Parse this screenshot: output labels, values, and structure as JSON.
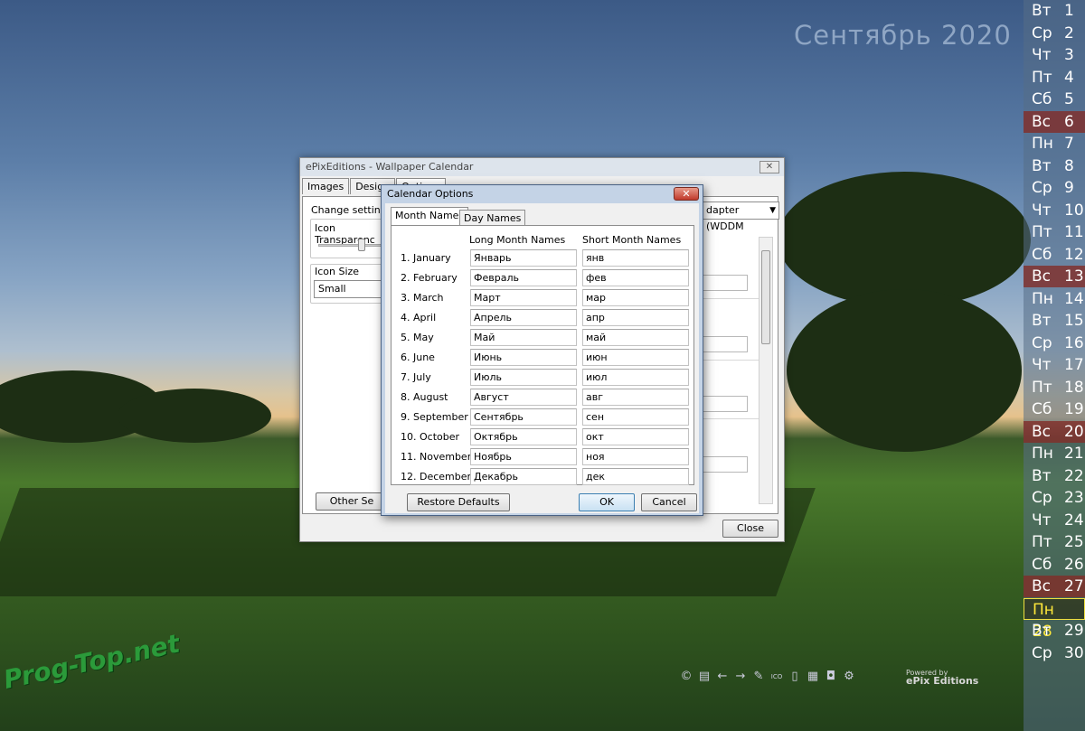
{
  "wallpaper": {
    "month_title": "Сентябрь 2020",
    "calendar_days": [
      {
        "dow": "Вт",
        "num": "1",
        "kind": "normal"
      },
      {
        "dow": "Ср",
        "num": "2",
        "kind": "normal"
      },
      {
        "dow": "Чт",
        "num": "3",
        "kind": "normal"
      },
      {
        "dow": "Пт",
        "num": "4",
        "kind": "normal"
      },
      {
        "dow": "Сб",
        "num": "5",
        "kind": "normal"
      },
      {
        "dow": "Вс",
        "num": "6",
        "kind": "weekend"
      },
      {
        "dow": "Пн",
        "num": "7",
        "kind": "normal"
      },
      {
        "dow": "Вт",
        "num": "8",
        "kind": "normal"
      },
      {
        "dow": "Ср",
        "num": "9",
        "kind": "normal"
      },
      {
        "dow": "Чт",
        "num": "10",
        "kind": "normal"
      },
      {
        "dow": "Пт",
        "num": "11",
        "kind": "normal"
      },
      {
        "dow": "Сб",
        "num": "12",
        "kind": "normal"
      },
      {
        "dow": "Вс",
        "num": "13",
        "kind": "weekend"
      },
      {
        "dow": "Пн",
        "num": "14",
        "kind": "normal"
      },
      {
        "dow": "Вт",
        "num": "15",
        "kind": "normal"
      },
      {
        "dow": "Ср",
        "num": "16",
        "kind": "normal"
      },
      {
        "dow": "Чт",
        "num": "17",
        "kind": "normal"
      },
      {
        "dow": "Пт",
        "num": "18",
        "kind": "normal"
      },
      {
        "dow": "Сб",
        "num": "19",
        "kind": "normal"
      },
      {
        "dow": "Вс",
        "num": "20",
        "kind": "weekend"
      },
      {
        "dow": "Пн",
        "num": "21",
        "kind": "normal"
      },
      {
        "dow": "Вт",
        "num": "22",
        "kind": "normal"
      },
      {
        "dow": "Ср",
        "num": "23",
        "kind": "normal"
      },
      {
        "dow": "Чт",
        "num": "24",
        "kind": "normal"
      },
      {
        "dow": "Пт",
        "num": "25",
        "kind": "normal"
      },
      {
        "dow": "Сб",
        "num": "26",
        "kind": "normal"
      },
      {
        "dow": "Вс",
        "num": "27",
        "kind": "weekend"
      },
      {
        "dow": "Пн",
        "num": "28",
        "kind": "today"
      },
      {
        "dow": "Вт",
        "num": "29",
        "kind": "normal"
      },
      {
        "dow": "Ср",
        "num": "30",
        "kind": "normal"
      }
    ],
    "powered_line1": "Powered by",
    "powered_line2": "ePix Editions",
    "watermark": "Prog-Top.net",
    "tray_icons": [
      "copyright-icon",
      "print-icon",
      "arrow-left-icon",
      "arrow-right-icon",
      "leaf-icon",
      "ico-icon",
      "document-icon",
      "grid-icon",
      "camera-icon",
      "settings-icon"
    ]
  },
  "main_window": {
    "title": "ePixEditions - Wallpaper Calendar",
    "close_glyph": "✕",
    "tabs": [
      "Images",
      "Design",
      "Options"
    ],
    "change_settings": "Change settings f",
    "icon_transparency": "Icon Transparenc",
    "icon_size_label": "Icon Size",
    "icon_size_value": "Small",
    "adapter_value": "dapter (WDDM",
    "other_settings": "Other Se",
    "close_button": "Close"
  },
  "dialog": {
    "title": "Calendar Options",
    "close_glyph": "✕",
    "tabs": [
      "Month Names",
      "Day Names"
    ],
    "col_long": "Long Month Names",
    "col_short": "Short Month Names",
    "months": [
      {
        "label": "1. January",
        "long": "Январь",
        "short": "янв"
      },
      {
        "label": "2. February",
        "long": "Февраль",
        "short": "фев"
      },
      {
        "label": "3. March",
        "long": "Март",
        "short": "мар"
      },
      {
        "label": "4. April",
        "long": "Апрель",
        "short": "апр"
      },
      {
        "label": "5. May",
        "long": "Май",
        "short": "май"
      },
      {
        "label": "6. June",
        "long": "Июнь",
        "short": "июн"
      },
      {
        "label": "7. July",
        "long": "Июль",
        "short": "июл"
      },
      {
        "label": "8. August",
        "long": "Август",
        "short": "авг"
      },
      {
        "label": "9. September",
        "long": "Сентябрь",
        "short": "сен"
      },
      {
        "label": "10. October",
        "long": "Октябрь",
        "short": "окт"
      },
      {
        "label": "11. November",
        "long": "Ноябрь",
        "short": "ноя"
      },
      {
        "label": "12. December",
        "long": "Декабрь",
        "short": "дек"
      }
    ],
    "restore_button": "Restore Defaults",
    "ok_button": "OK",
    "cancel_button": "Cancel"
  }
}
